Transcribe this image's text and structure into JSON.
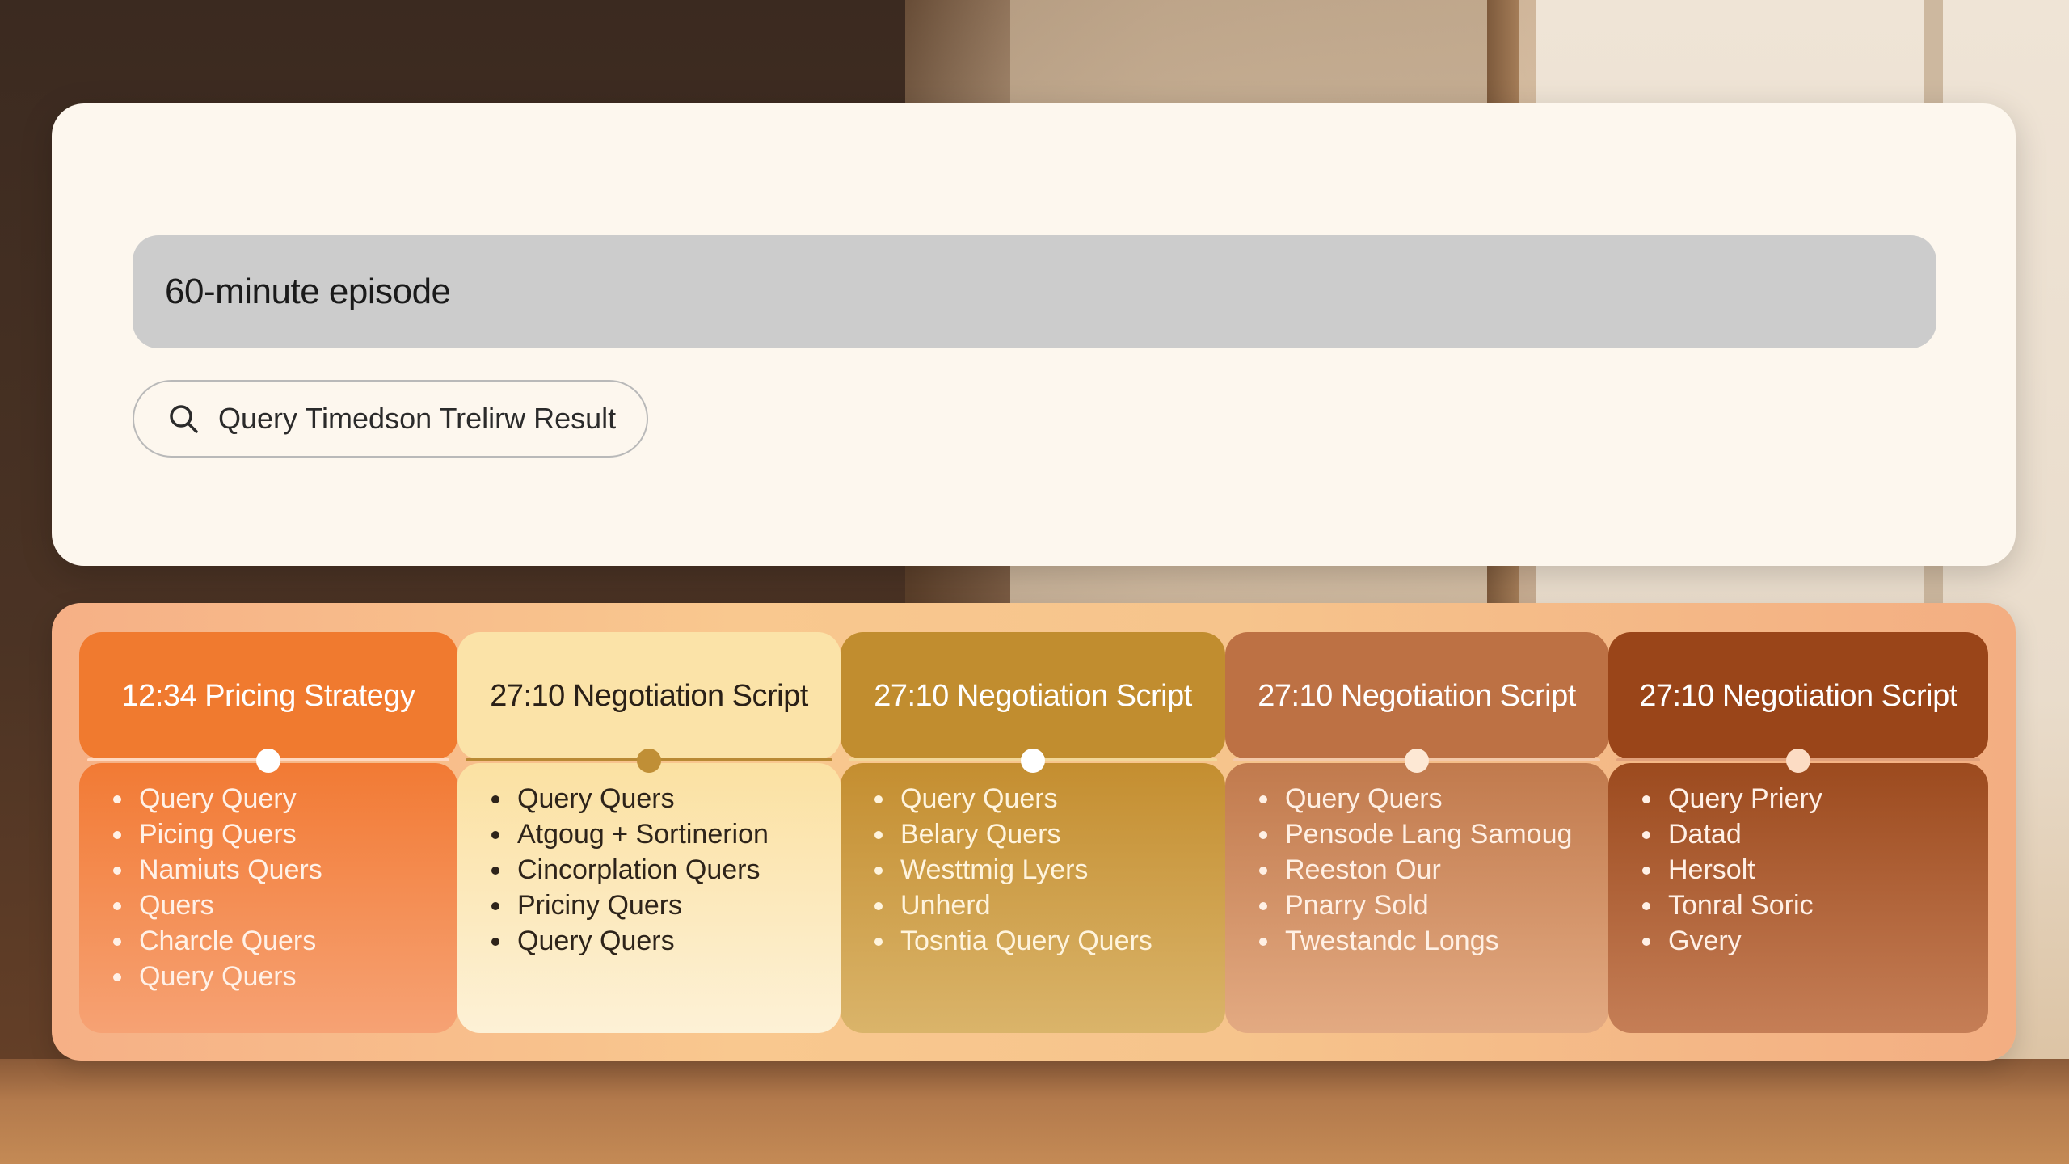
{
  "header": {
    "title": "60-minute episode",
    "query": {
      "label": "Query Timedson Trelirw Result",
      "icon": "search-icon"
    }
  },
  "timeline": {
    "columns": [
      {
        "title": "12:34 Pricing Strategy",
        "items": [
          "Query Query",
          "Picing Quers",
          "Namiuts Quers",
          "Quers",
          "Charcle Quers",
          "Query Quers"
        ]
      },
      {
        "title": "27:10 Negotiation Script",
        "items": [
          "Query Quers",
          "Atgoug + Sortinerion",
          "Cincorplation Quers",
          "Priciny Quers",
          "Query Quers"
        ]
      },
      {
        "title": "27:10 Negotiation Script",
        "items": [
          "Query Quers",
          "Belary Quers",
          "Westtmig Lyers",
          "Unherd",
          "Tosntia Query Quers"
        ]
      },
      {
        "title": "27:10 Negotiation Script",
        "items": [
          "Query Quers",
          "Pensode Lang Samoug",
          "Reeston Our",
          "Pnarry Sold",
          "Twestandc Longs"
        ]
      },
      {
        "title": "27:10 Negotiation Script",
        "items": [
          "Query Priery",
          "Datad",
          "Hersolt",
          "Tonral Soric",
          "Gvery"
        ]
      }
    ]
  },
  "colors": {
    "card_bg": "#fdf7ee",
    "title_bar": "#cccccc",
    "col1": "#f07a2f",
    "col2": "#fbe3a8",
    "col3": "#c18d2f",
    "col4": "#bd7144",
    "col5": "#9a4519"
  }
}
